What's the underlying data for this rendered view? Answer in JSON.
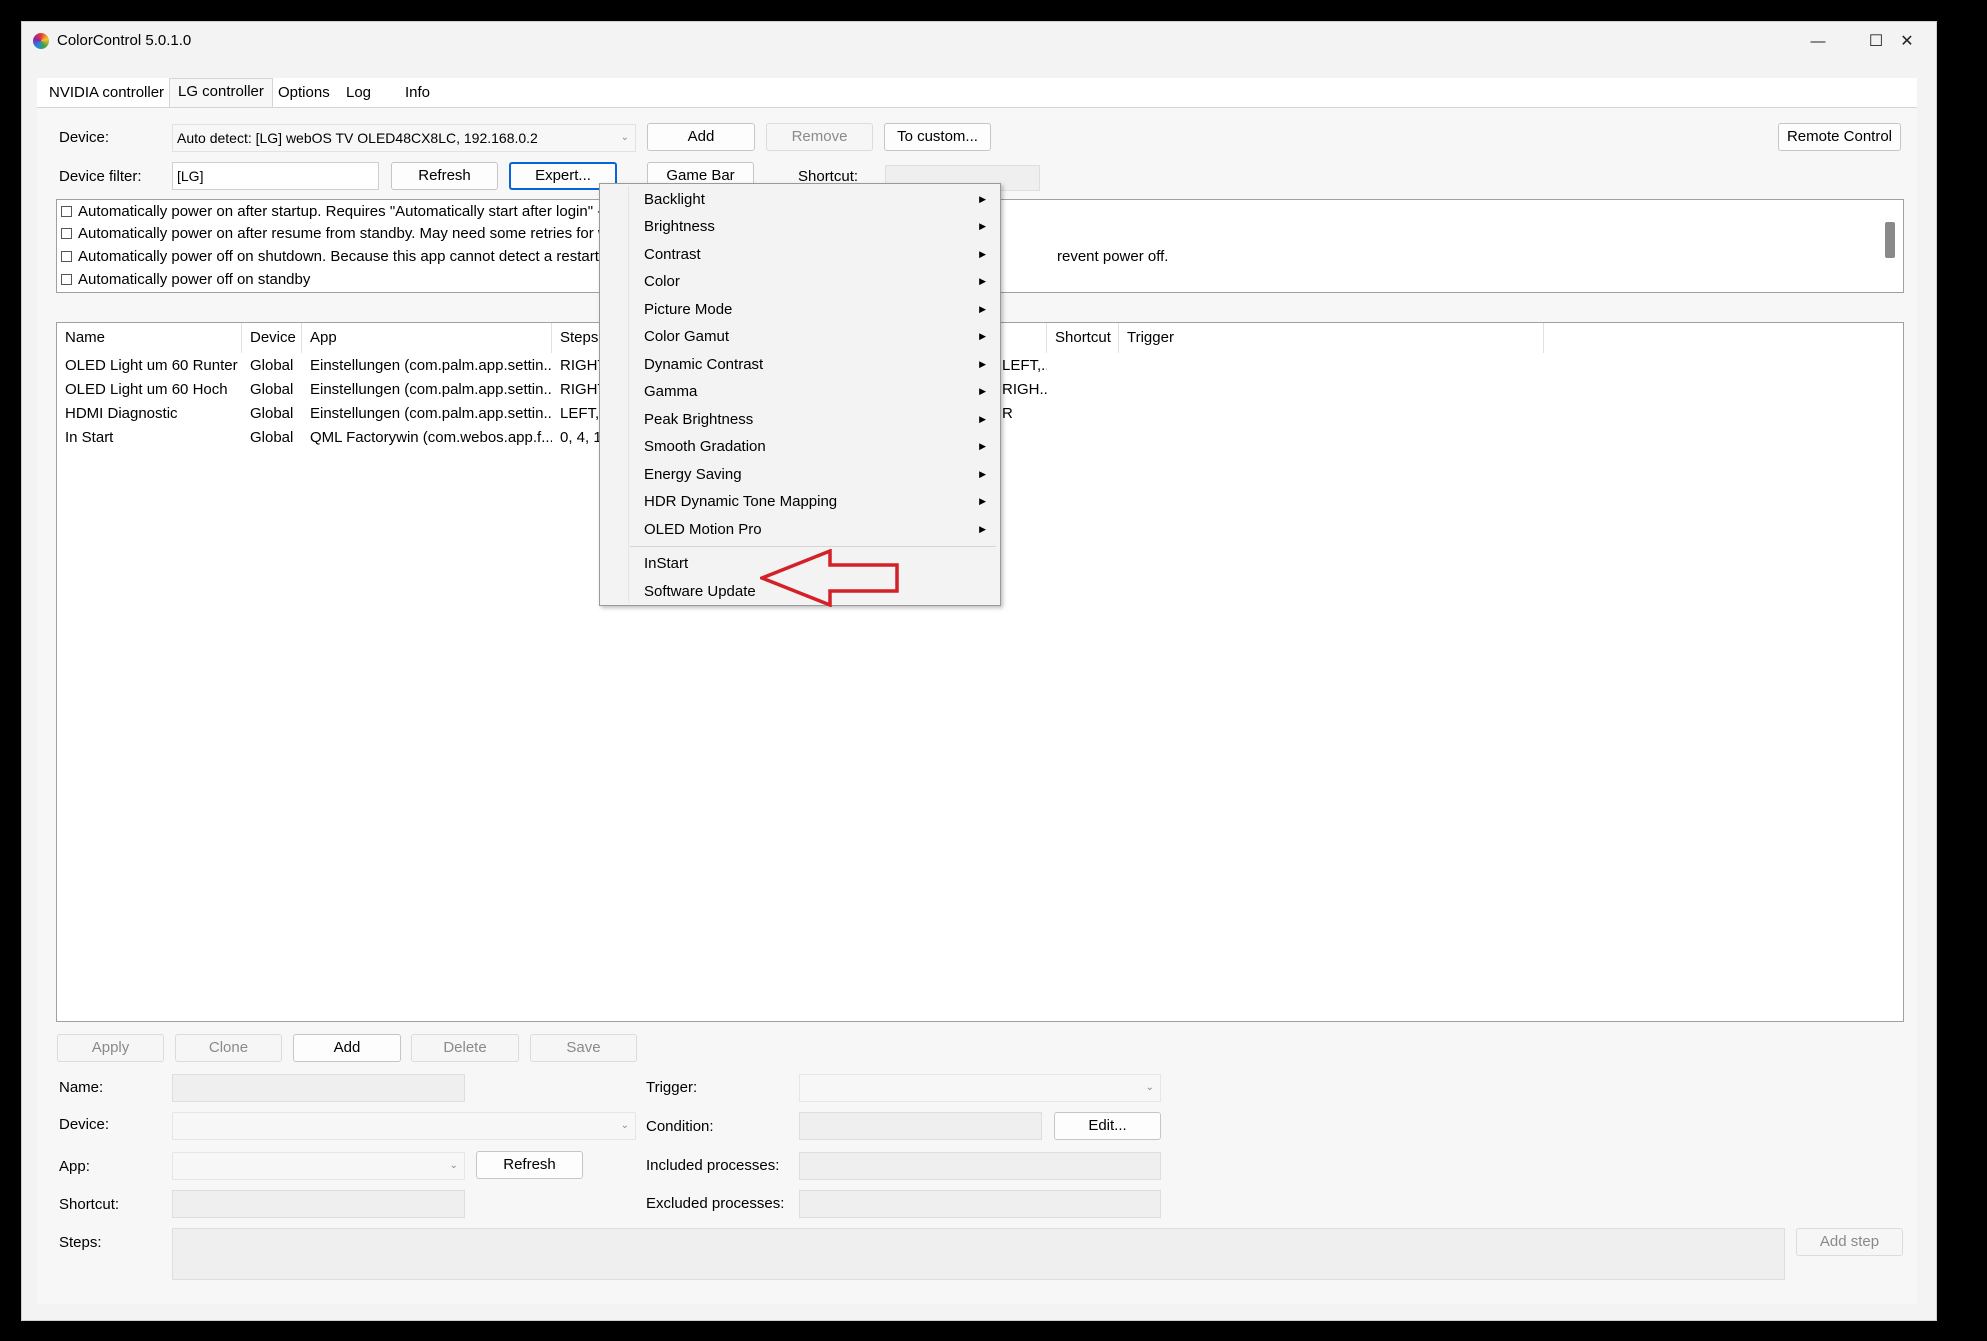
{
  "window": {
    "title": "ColorControl 5.0.1.0",
    "minimize_glyph": "—",
    "maximize_glyph": "☐",
    "close_glyph": "✕"
  },
  "tabs": [
    {
      "label": "NVIDIA controller"
    },
    {
      "label": "LG controller",
      "active": true
    },
    {
      "label": "Options"
    },
    {
      "label": "Log"
    },
    {
      "label": "Info"
    }
  ],
  "device_row": {
    "label": "Device:",
    "value": "Auto detect: [LG] webOS TV OLED48CX8LC, 192.168.0.2",
    "add": "Add",
    "remove": "Remove",
    "to_custom": "To custom...",
    "remote_control": "Remote Control"
  },
  "filter_row": {
    "label": "Device filter:",
    "value": "[LG]",
    "refresh": "Refresh",
    "expert": "Expert...",
    "game_bar": "Game Bar",
    "shortcut_label": "Shortcut:"
  },
  "options": [
    "Automatically power on after startup. Requires \"Automatically start after login\" - s",
    "Automatically power on after resume from standby. May need some retries for wa",
    "Automatically power off on shutdown. Because this app cannot detect a restart, re",
    "Automatically power off on standby"
  ],
  "options_overflow_text": "revent power off.",
  "grid": {
    "columns": [
      "Name",
      "Device",
      "App",
      "Steps",
      "Shortcut",
      "Trigger"
    ],
    "rows": [
      {
        "name": "OLED Light um 60 Runter",
        "device": "Global",
        "app": "Einstellungen (com.palm.app.settin...",
        "steps": "RIGHT",
        "steps_tail": "LEFT,..."
      },
      {
        "name": "OLED Light um 60 Hoch",
        "device": "Global",
        "app": "Einstellungen (com.palm.app.settin...",
        "steps": "RIGHT",
        "steps_tail": "RIGH..."
      },
      {
        "name": "HDMI Diagnostic",
        "device": "Global",
        "app": "Einstellungen (com.palm.app.settin...",
        "steps": "LEFT, L",
        "steps_tail": "R"
      },
      {
        "name": "In Start",
        "device": "Global",
        "app": "QML Factorywin (com.webos.app.f...",
        "steps": "0, 4, 1,",
        "steps_tail": ""
      }
    ]
  },
  "expert_menu": {
    "items": [
      {
        "label": "Backlight",
        "submenu": true
      },
      {
        "label": "Brightness",
        "submenu": true
      },
      {
        "label": "Contrast",
        "submenu": true
      },
      {
        "label": "Color",
        "submenu": true
      },
      {
        "label": "Picture Mode",
        "submenu": true
      },
      {
        "label": "Color Gamut",
        "submenu": true
      },
      {
        "label": "Dynamic Contrast",
        "submenu": true
      },
      {
        "label": "Gamma",
        "submenu": true
      },
      {
        "label": "Peak Brightness",
        "submenu": true
      },
      {
        "label": "Smooth Gradation",
        "submenu": true
      },
      {
        "label": "Energy Saving",
        "submenu": true
      },
      {
        "label": "HDR Dynamic Tone Mapping",
        "submenu": true
      },
      {
        "label": "OLED Motion Pro",
        "submenu": true
      }
    ],
    "actions": [
      {
        "label": "InStart"
      },
      {
        "label": "Software Update"
      }
    ],
    "submenu_glyph": "▶",
    "annotation_color": "#d42027"
  },
  "actions": {
    "apply": "Apply",
    "clone": "Clone",
    "add": "Add",
    "delete": "Delete",
    "save": "Save"
  },
  "editor": {
    "name_label": "Name:",
    "device_label": "Device:",
    "app_label": "App:",
    "app_refresh": "Refresh",
    "shortcut_label": "Shortcut:",
    "steps_label": "Steps:",
    "trigger_label": "Trigger:",
    "condition_label": "Condition:",
    "edit_button": "Edit...",
    "included_label": "Included processes:",
    "excluded_label": "Excluded processes:",
    "add_step": "Add step"
  }
}
